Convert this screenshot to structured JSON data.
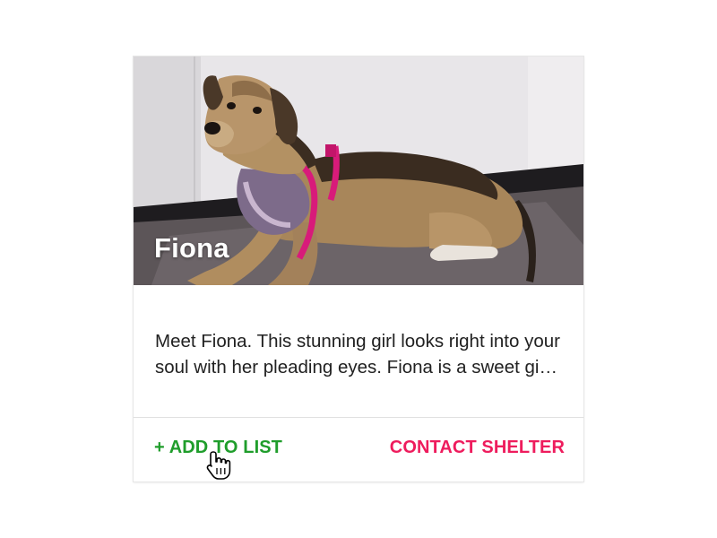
{
  "card": {
    "title": "Fiona",
    "description": "Meet Fiona. This stunning girl looks right into your soul with her pleading eyes. Fiona is a sweet girl who is looking for her forever home.",
    "image_alt": "Fiona"
  },
  "actions": {
    "add_to_list": "+ ADD TO LIST",
    "contact_shelter": "CONTACT SHELTER"
  },
  "colors": {
    "add_to_list": "#1f9d2b",
    "contact_shelter": "#ee1c5d",
    "title_text": "#ffffff",
    "body_text": "#212121"
  },
  "cursor": {
    "icon": "hand-pointer-icon"
  }
}
